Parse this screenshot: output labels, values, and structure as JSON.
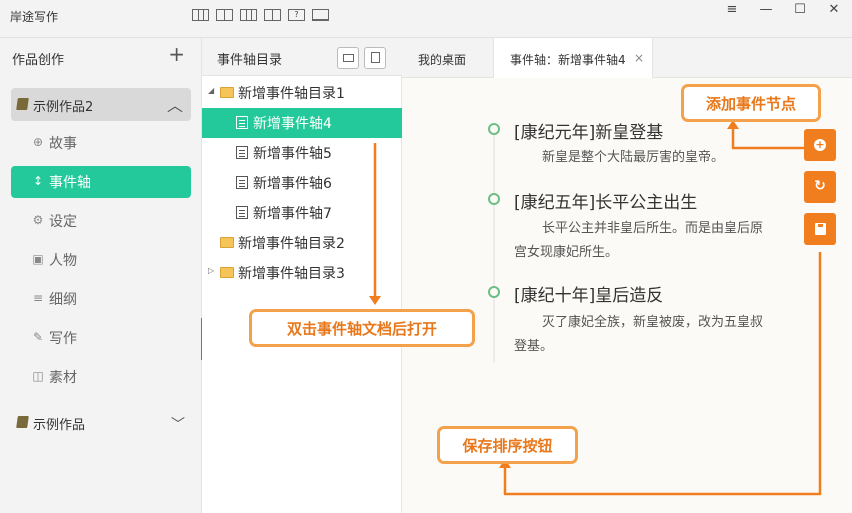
{
  "app": {
    "title": "岸途写作"
  },
  "window_controls": [
    "≡",
    "—",
    "☐",
    "✕"
  ],
  "sidebar": {
    "header": "作品创作",
    "add_label": "+",
    "group_expanded": {
      "label": "示例作品2",
      "chevron": "︿"
    },
    "items": [
      {
        "label": "故事",
        "icon": "story-icon",
        "glyph": "⊕"
      },
      {
        "label": "事件轴",
        "icon": "timeline-icon",
        "glyph": "↕",
        "active": true
      },
      {
        "label": "设定",
        "icon": "settings-icon",
        "glyph": "⚙"
      },
      {
        "label": "人物",
        "icon": "person-card-icon",
        "glyph": "▣"
      },
      {
        "label": "细纲",
        "icon": "outline-icon",
        "glyph": "≡"
      },
      {
        "label": "写作",
        "icon": "pencil-icon",
        "glyph": "✎"
      },
      {
        "label": "素材",
        "icon": "material-icon",
        "glyph": "◫"
      }
    ],
    "group_collapsed": {
      "label": "示例作品",
      "chevron": "﹀"
    }
  },
  "tree": {
    "title": "事件轴目录",
    "rows": [
      {
        "label": "新增事件轴目录1",
        "type": "folder",
        "expanded": true
      },
      {
        "label": "新增事件轴4",
        "type": "doc",
        "selected": true
      },
      {
        "label": "新增事件轴5",
        "type": "doc"
      },
      {
        "label": "新增事件轴6",
        "type": "doc"
      },
      {
        "label": "新增事件轴7",
        "type": "doc"
      },
      {
        "label": "新增事件轴目录2",
        "type": "folder"
      },
      {
        "label": "新增事件轴目录3",
        "type": "folder",
        "expandable": true
      }
    ]
  },
  "tabs": [
    {
      "label": "我的桌面"
    },
    {
      "label": "事件轴：新增事件轴4",
      "active": true,
      "close": "×"
    }
  ],
  "timeline": {
    "events": [
      {
        "title": "[康纪元年]新皇登基",
        "body": "新皇是整个大陆最厉害的皇帝。"
      },
      {
        "title": "[康纪五年]长平公主出生",
        "body": "长平公主并非皇后所生。而是由皇后原宫女现康妃所生。"
      },
      {
        "title": "[康纪十年]皇后造反",
        "body": "灭了康妃全族，新皇被废，改为五皇叔登基。"
      }
    ]
  },
  "fab_buttons": [
    {
      "name": "add-event-node",
      "glyph": "+"
    },
    {
      "name": "refresh",
      "glyph": "↻"
    },
    {
      "name": "save-order",
      "glyph": ""
    }
  ],
  "callouts": {
    "add_event": "添加事件节点",
    "double_click": "双击事件轴文档后打开",
    "save_order": "保存排序按钮"
  },
  "colors": {
    "accent": "#23c99a",
    "orange": "#f07e1e",
    "callout_border": "#f4a14b"
  }
}
